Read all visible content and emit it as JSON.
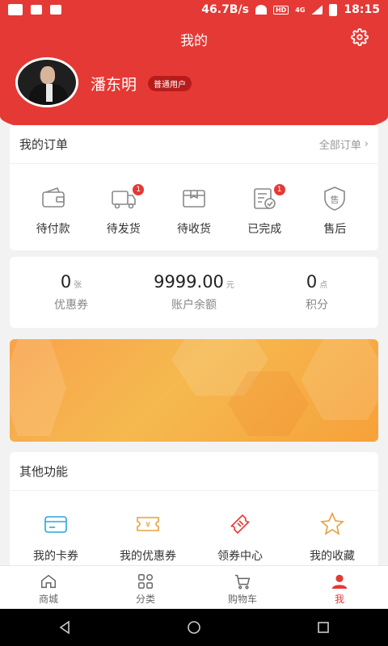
{
  "status": {
    "net_speed": "46.7B/s",
    "hd": "HD",
    "net_type": "4G",
    "time": "18:15"
  },
  "header": {
    "title": "我的",
    "username": "潘东明",
    "badge": "普通用户"
  },
  "orders": {
    "title": "我的订单",
    "more": "全部订单",
    "items": [
      {
        "label": "待付款",
        "icon": "wallet-icon",
        "count": ""
      },
      {
        "label": "待发货",
        "icon": "truck-icon",
        "count": "1"
      },
      {
        "label": "待收货",
        "icon": "box-icon",
        "count": ""
      },
      {
        "label": "已完成",
        "icon": "check-list-icon",
        "count": "1"
      },
      {
        "label": "售后",
        "icon": "shield-icon",
        "count": ""
      }
    ]
  },
  "assets": [
    {
      "value": "0",
      "unit": "张",
      "label": "优惠券"
    },
    {
      "value": "9999.00",
      "unit": "元",
      "label": "账户余额"
    },
    {
      "value": "0",
      "unit": "点",
      "label": "积分"
    }
  ],
  "other": {
    "title": "其他功能",
    "items": [
      {
        "label": "我的卡券",
        "icon": "card-icon"
      },
      {
        "label": "我的优惠券",
        "icon": "coupon-icon"
      },
      {
        "label": "领券中心",
        "icon": "ticket-icon"
      },
      {
        "label": "我的收藏",
        "icon": "star-icon"
      }
    ]
  },
  "tabs": [
    {
      "label": "商城",
      "icon": "home-icon",
      "active": false
    },
    {
      "label": "分类",
      "icon": "grid-icon",
      "active": false
    },
    {
      "label": "购物车",
      "icon": "cart-icon",
      "active": false
    },
    {
      "label": "我",
      "icon": "person-icon",
      "active": true
    }
  ],
  "colors": {
    "primary": "#e53935",
    "banner_start": "#f9a34b",
    "banner_end": "#f7a13a",
    "accent_blue": "#2aa7d6",
    "accent_orange": "#e8a03d"
  }
}
